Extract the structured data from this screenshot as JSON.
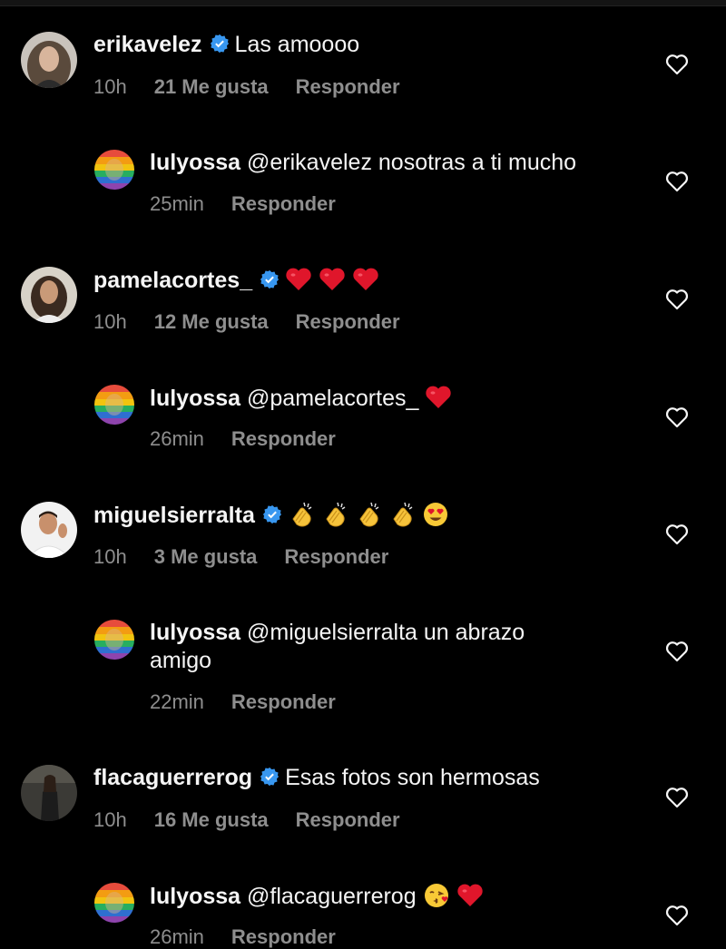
{
  "comments": [
    {
      "username": "erikavelez",
      "verified": true,
      "text": "Las amoooo",
      "time": "10h",
      "likes": "21 Me gusta",
      "reply_label": "Responder",
      "avatar_icon": "woman-portrait-avatar"
    },
    {
      "username": "lulyossa",
      "text": "@erikavelez nosotras a ti mucho",
      "time": "25min",
      "reply_label": "Responder",
      "avatar_icon": "rainbow-avatar"
    },
    {
      "username": "pamelacortes_",
      "verified": true,
      "emojis": [
        "red-heart-emoji",
        "red-heart-emoji",
        "red-heart-emoji"
      ],
      "time": "10h",
      "likes": "12 Me gusta",
      "reply_label": "Responder",
      "avatar_icon": "woman-portrait-avatar"
    },
    {
      "username": "lulyossa",
      "text": "@pamelacortes_",
      "emojis": [
        "red-heart-emoji"
      ],
      "time": "26min",
      "reply_label": "Responder",
      "avatar_icon": "rainbow-avatar"
    },
    {
      "username": "miguelsierralta",
      "verified": true,
      "emojis": [
        "clapping-hands-emoji",
        "clapping-hands-emoji",
        "clapping-hands-emoji",
        "clapping-hands-emoji",
        "heart-eyes-emoji"
      ],
      "time": "10h",
      "likes": "3 Me gusta",
      "reply_label": "Responder",
      "avatar_icon": "man-portrait-avatar"
    },
    {
      "username": "lulyossa",
      "text": "@miguelsierralta un abrazo",
      "text_cont": "amigo",
      "time": "22min",
      "reply_label": "Responder",
      "avatar_icon": "rainbow-avatar"
    },
    {
      "username": "flacaguerrerog",
      "verified": true,
      "text": "Esas fotos son hermosas",
      "time": "10h",
      "likes": "16 Me gusta",
      "reply_label": "Responder",
      "avatar_icon": "woman-portrait-avatar"
    },
    {
      "username": "lulyossa",
      "text": "@flacaguerrerog",
      "emojis": [
        "kiss-face-emoji",
        "red-heart-emoji"
      ],
      "time": "26min",
      "reply_label": "Responder",
      "avatar_icon": "rainbow-avatar"
    }
  ],
  "colors": {
    "background": "#000000",
    "text": "#f5f5f5",
    "meta": "#8e8e8e",
    "verified_badge": "#3897f0",
    "heart_emoji": "#e0162b"
  }
}
